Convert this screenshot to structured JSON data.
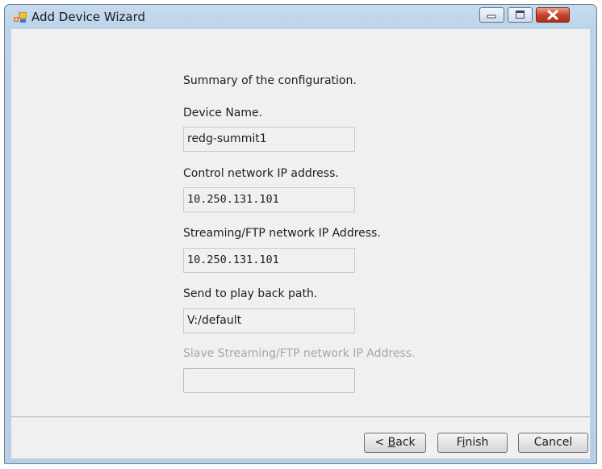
{
  "window": {
    "title": "Add Device Wizard"
  },
  "summary": {
    "heading": "Summary of the configuration.",
    "device_name_label": "Device Name.",
    "device_name_value": "redg-summit1",
    "control_ip_label": "Control network IP address.",
    "control_ip_value": "10.250.131.101",
    "streaming_ip_label": "Streaming/FTP network IP Address.",
    "streaming_ip_value": "10.250.131.101",
    "playback_label": "Send to play back path.",
    "playback_value": "V:/default",
    "slave_ip_label": "Slave Streaming/FTP network IP Address.",
    "slave_ip_value": ""
  },
  "buttons": {
    "back_prefix": "< ",
    "back_accel": "B",
    "back_rest": "ack",
    "finish_pre": "F",
    "finish_accel": "i",
    "finish_rest": "nish",
    "cancel": "Cancel"
  }
}
